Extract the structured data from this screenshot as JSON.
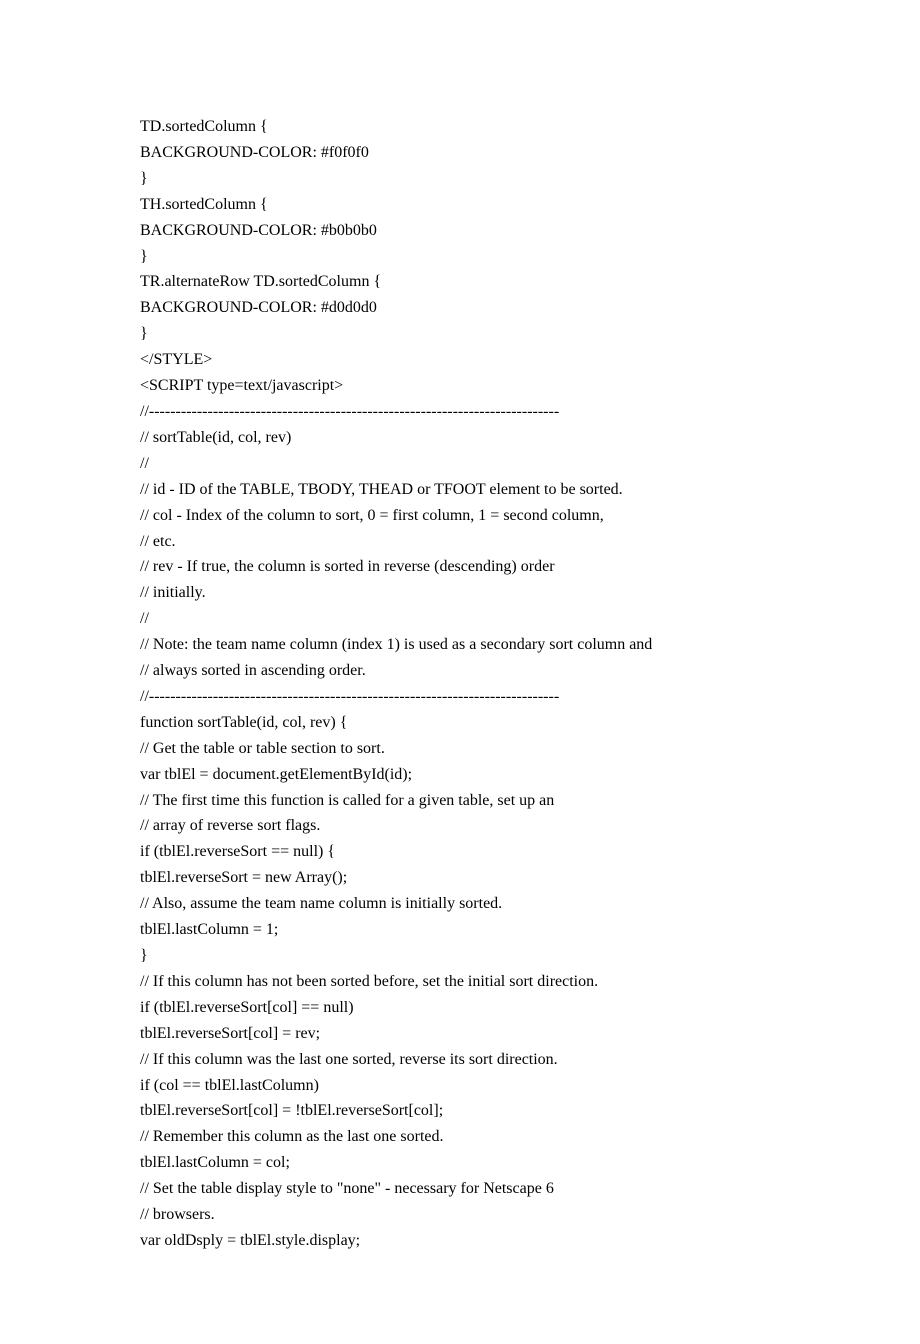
{
  "lines": [
    "TD.sortedColumn {",
    "BACKGROUND-COLOR: #f0f0f0",
    "}",
    "TH.sortedColumn {",
    "BACKGROUND-COLOR: #b0b0b0",
    "}",
    "TR.alternateRow TD.sortedColumn {",
    "BACKGROUND-COLOR: #d0d0d0",
    "}",
    "</STYLE>",
    "<SCRIPT type=text/javascript>",
    "//-----------------------------------------------------------------------------",
    "// sortTable(id, col, rev)",
    "//",
    "// id - ID of the TABLE, TBODY, THEAD or TFOOT element to be sorted.",
    "// col - Index of the column to sort, 0 = first column, 1 = second column,",
    "// etc.",
    "// rev - If true, the column is sorted in reverse (descending) order",
    "// initially.",
    "//",
    "// Note: the team name column (index 1) is used as a secondary sort column and",
    "// always sorted in ascending order.",
    "//-----------------------------------------------------------------------------",
    "function sortTable(id, col, rev) {",
    "// Get the table or table section to sort.",
    "var tblEl = document.getElementById(id);",
    "// The first time this function is called for a given table, set up an",
    "// array of reverse sort flags.",
    "if (tblEl.reverseSort == null) {",
    "tblEl.reverseSort = new Array();",
    "// Also, assume the team name column is initially sorted.",
    "tblEl.lastColumn = 1;",
    "}",
    "// If this column has not been sorted before, set the initial sort direction.",
    "if (tblEl.reverseSort[col] == null)",
    "tblEl.reverseSort[col] = rev;",
    "// If this column was the last one sorted, reverse its sort direction.",
    "if (col == tblEl.lastColumn)",
    "tblEl.reverseSort[col] = !tblEl.reverseSort[col];",
    "// Remember this column as the last one sorted.",
    "tblEl.lastColumn = col;",
    "// Set the table display style to \"none\" - necessary for Netscape 6",
    "// browsers.",
    "var oldDsply = tblEl.style.display;"
  ]
}
